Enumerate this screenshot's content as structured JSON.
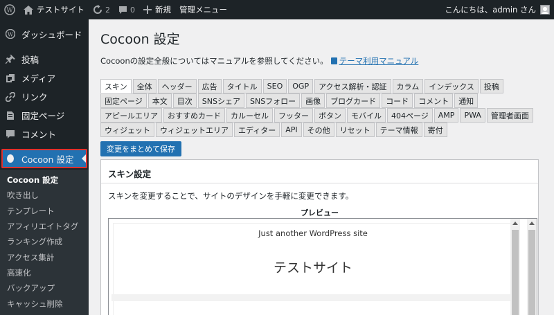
{
  "adminbar": {
    "site_name": "テストサイト",
    "updates_count": "2",
    "comments_count": "0",
    "new_label": "新規",
    "admin_menu_label": "管理メニュー",
    "greeting": "こんにちは、admin さん"
  },
  "sidebar": {
    "items": [
      {
        "label": "ダッシュボード",
        "icon": "dashboard-icon"
      },
      {
        "label": "投稿",
        "icon": "pin-icon"
      },
      {
        "label": "メディア",
        "icon": "media-icon"
      },
      {
        "label": "リンク",
        "icon": "link-icon"
      },
      {
        "label": "固定ページ",
        "icon": "page-icon"
      },
      {
        "label": "コメント",
        "icon": "comment-icon"
      },
      {
        "label": "Cocoon 設定",
        "icon": "cocoon-icon"
      }
    ],
    "submenu": [
      "Cocoon 設定",
      "吹き出し",
      "テンプレート",
      "アフィリエイトタグ",
      "ランキング作成",
      "アクセス集計",
      "高速化",
      "バックアップ",
      "キャッシュ削除"
    ]
  },
  "main": {
    "title": "Cocoon 設定",
    "intro_text": "Cocoonの設定全般についてはマニュアルを参照してください。",
    "manual_link": "テーマ利用マニュアル",
    "tabs": [
      [
        "スキン",
        "全体",
        "ヘッダー",
        "広告",
        "タイトル",
        "SEO",
        "OGP",
        "アクセス解析・認証",
        "カラム",
        "インデックス",
        "投稿"
      ],
      [
        "固定ページ",
        "本文",
        "目次",
        "SNSシェア",
        "SNSフォロー",
        "画像",
        "ブログカード",
        "コード",
        "コメント",
        "通知"
      ],
      [
        "アピールエリア",
        "おすすめカード",
        "カルーセル",
        "フッター",
        "ボタン",
        "モバイル",
        "404ページ",
        "AMP",
        "PWA",
        "管理者画面"
      ],
      [
        "ウィジェット",
        "ウィジェットエリア",
        "エディター",
        "API",
        "その他",
        "リセット",
        "テーマ情報",
        "寄付"
      ]
    ],
    "save_button": "変更をまとめて保存",
    "panel": {
      "title": "スキン設定",
      "description": "スキンを変更することで、サイトのデザインを手軽に変更できます。",
      "preview_label": "プレビュー",
      "preview_tagline": "Just another WordPress site",
      "preview_site_title": "テストサイト"
    }
  }
}
